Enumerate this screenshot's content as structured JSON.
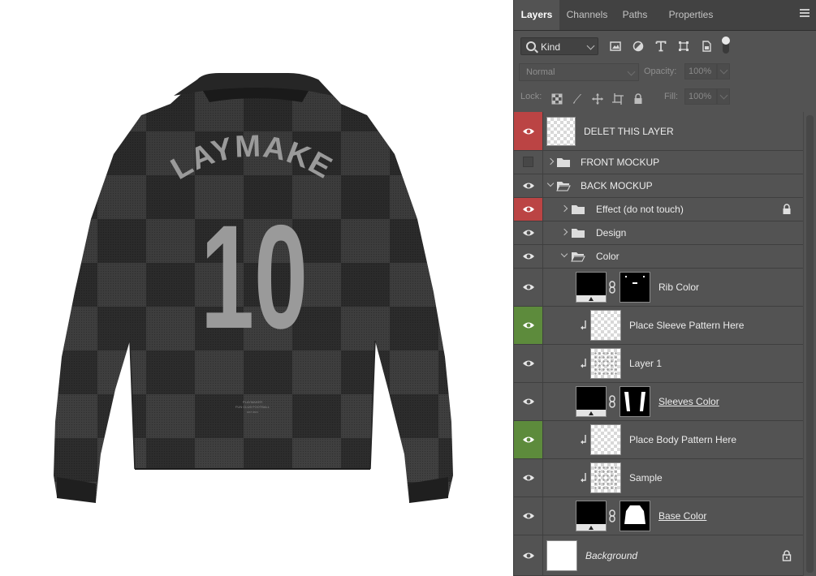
{
  "canvas": {
    "jersey_name": "PLAYMAKER",
    "jersey_number": "10",
    "footer_brand": "PLAYMAKER",
    "footer_club": "FUN CLUB FOOTBALL",
    "footer_small": "EST 2024"
  },
  "panel": {
    "tabs": [
      {
        "label": "Layers",
        "active": true
      },
      {
        "label": "Channels"
      },
      {
        "label": "Paths"
      },
      {
        "label": "Properties"
      }
    ],
    "filter": {
      "kind_label": "Kind"
    },
    "blend": {
      "mode": "Normal",
      "opacity_label": "Opacity:",
      "opacity_value": "100%"
    },
    "lock_row": {
      "lock_label": "Lock:",
      "fill_label": "Fill:",
      "fill_value": "100%"
    },
    "layers": [
      {
        "name": "DELET THIS LAYER",
        "visible": true,
        "eye_color": "red"
      },
      {
        "name": "FRONT MOCKUP",
        "visible": false,
        "type": "group",
        "expanded": false
      },
      {
        "name": "BACK MOCKUP",
        "visible": true,
        "type": "group",
        "expanded": true
      },
      {
        "name": "Effect (do not touch)",
        "visible": true,
        "eye_color": "red",
        "type": "group",
        "expanded": false,
        "locked": true
      },
      {
        "name": "Design",
        "visible": true,
        "type": "group",
        "expanded": false
      },
      {
        "name": "Color",
        "visible": true,
        "type": "group",
        "expanded": true
      },
      {
        "name": "Rib Color",
        "visible": true,
        "type": "fill-with-mask"
      },
      {
        "name": "Place Sleeve Pattern Here",
        "visible": true,
        "eye_color": "green",
        "clipped": true
      },
      {
        "name": "Layer 1",
        "visible": true,
        "clipped": true
      },
      {
        "name": "Sleeves Color",
        "visible": true,
        "type": "fill-with-mask"
      },
      {
        "name": "Place Body Pattern Here",
        "visible": true,
        "eye_color": "green",
        "clipped": true
      },
      {
        "name": "Sample",
        "visible": true,
        "clipped": true
      },
      {
        "name": "Base Color",
        "visible": true,
        "type": "fill-with-mask"
      },
      {
        "name": "Background",
        "visible": true,
        "locked": true
      }
    ]
  },
  "colors": {
    "panel_bg": "#535353",
    "tab_bar_bg": "#424242",
    "eye_red": "#bb4444",
    "eye_green": "#5d8b3c",
    "jersey_dark": "#2f2f2f",
    "jersey_print": "#9a9a9a"
  },
  "icons": [
    "search-icon",
    "image-filter-icon",
    "adjustment-filter-icon",
    "type-filter-icon",
    "shape-filter-icon",
    "smart-object-filter-icon",
    "filter-toggle",
    "lock-transparent-icon",
    "lock-paint-icon",
    "lock-position-icon",
    "lock-artboard-icon",
    "lock-all-icon",
    "eye-icon",
    "folder-icon",
    "chain-link-icon",
    "clip-arrow-icon",
    "lock-icon",
    "panel-menu-icon"
  ]
}
